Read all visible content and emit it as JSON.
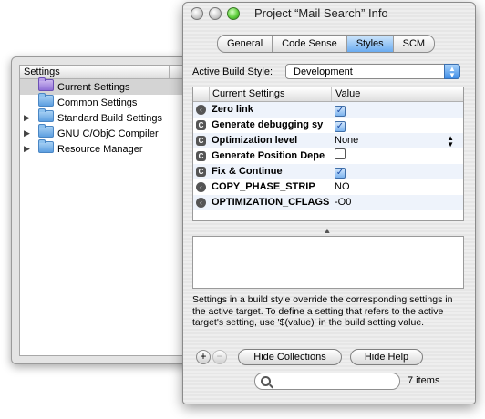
{
  "settings_panel": {
    "header": "Settings",
    "items": [
      {
        "label": "Current Settings",
        "expandable": false,
        "selected": true
      },
      {
        "label": "Common Settings",
        "expandable": false,
        "selected": false
      },
      {
        "label": "Standard Build Settings",
        "expandable": true,
        "selected": false
      },
      {
        "label": "GNU C/ObjC Compiler",
        "expandable": true,
        "selected": false
      },
      {
        "label": "Resource Manager",
        "expandable": true,
        "selected": false
      }
    ]
  },
  "window": {
    "title": "Project “Mail Search” Info",
    "tabs": [
      {
        "label": "General",
        "active": false
      },
      {
        "label": "Code Sense",
        "active": false
      },
      {
        "label": "Styles",
        "active": true
      },
      {
        "label": "SCM",
        "active": false
      }
    ],
    "build_style_label": "Active Build Style:",
    "build_style_value": "Development",
    "table": {
      "col_name": "Current Settings",
      "col_value": "Value",
      "rows": [
        {
          "icon": "circle",
          "name": "Zero link",
          "value_type": "checkbox",
          "checked": true,
          "value": ""
        },
        {
          "icon": "square",
          "name": "Generate debugging sy",
          "value_type": "checkbox",
          "checked": true,
          "value": ""
        },
        {
          "icon": "square",
          "name": "Optimization level",
          "value_type": "popup",
          "checked": false,
          "value": "None"
        },
        {
          "icon": "square",
          "name": "Generate Position Depe",
          "value_type": "checkbox",
          "checked": false,
          "value": ""
        },
        {
          "icon": "square",
          "name": "Fix & Continue",
          "value_type": "checkbox",
          "checked": true,
          "value": ""
        },
        {
          "icon": "circle",
          "name": "COPY_PHASE_STRIP",
          "value_type": "text",
          "checked": false,
          "value": "NO"
        },
        {
          "icon": "circle",
          "name": "OPTIMIZATION_CFLAGS",
          "value_type": "text",
          "checked": false,
          "value": "-O0"
        }
      ]
    },
    "help_text": "Settings in a build style override the corresponding settings in the active target. To define a setting that refers to the active target's setting, use '$(value)' in the build setting value.",
    "add_label": "+",
    "remove_label": "−",
    "hide_collections_label": "Hide Collections",
    "hide_help_label": "Hide Help",
    "search_placeholder": "",
    "item_count": "7 items"
  },
  "colors": {
    "accent": "#3e8de6",
    "zoom_button": "#5fcf3c",
    "selected_row": "#d4d4d4"
  }
}
